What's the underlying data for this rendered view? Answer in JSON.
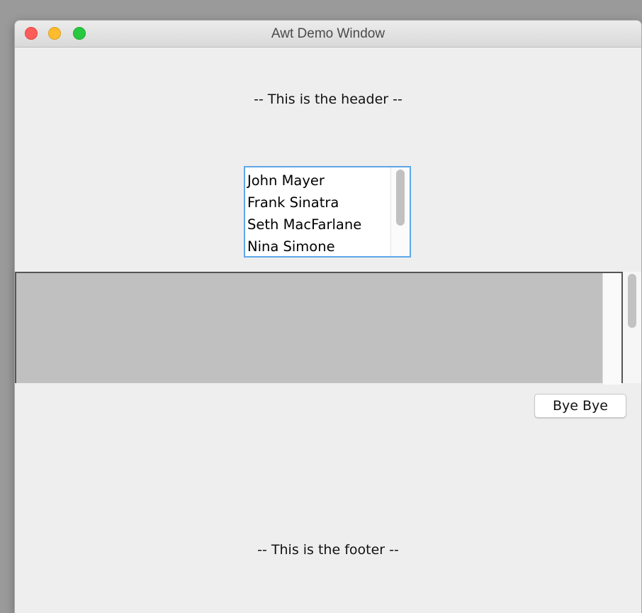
{
  "window": {
    "title": "Awt Demo Window",
    "controls": [
      "close-icon",
      "minimize-icon",
      "zoom-icon"
    ]
  },
  "header_label": "-- This is the header --",
  "list": {
    "items": [
      "John Mayer",
      "Frank Sinatra",
      "Seth MacFarlane",
      "Nina Simone"
    ]
  },
  "text_area": {
    "value": ""
  },
  "bye_button": {
    "label": "Bye Bye"
  },
  "footer_label": "-- This is the footer --",
  "colors": {
    "close": "#fd5d58",
    "minimize": "#fdbc2e",
    "zoom": "#28c840",
    "list_focus_border": "#5ea6e8",
    "window_background": "#eeeeee",
    "text_area_background": "#c0c0c0"
  }
}
